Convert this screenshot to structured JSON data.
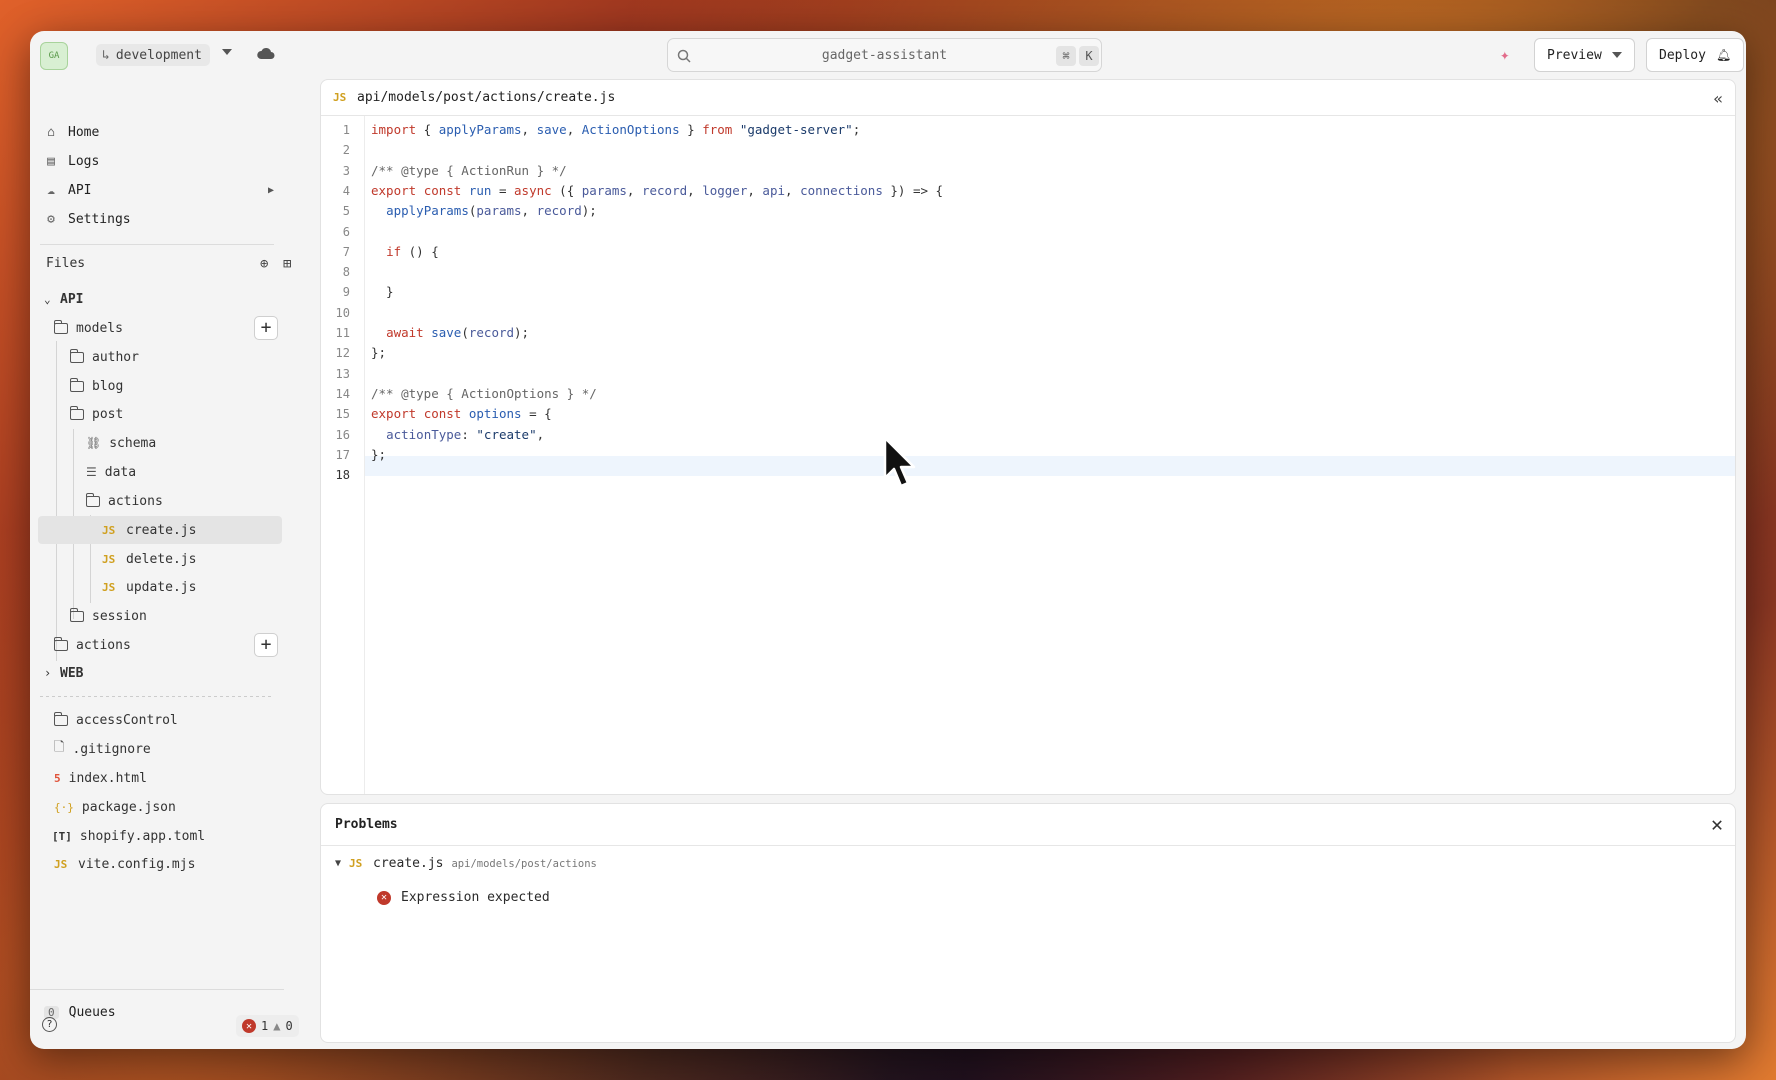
{
  "topbar": {
    "logo_text": "GA",
    "branch": "development",
    "search_value": "gadget-assistant",
    "shortcut_keys": [
      "⌘",
      "K"
    ],
    "preview_label": "Preview",
    "deploy_label": "Deploy"
  },
  "sidebar": {
    "nav": [
      {
        "label": "Home",
        "icon": "home-icon"
      },
      {
        "label": "Logs",
        "icon": "logs-icon"
      },
      {
        "label": "API",
        "icon": "cloud-icon"
      },
      {
        "label": "Settings",
        "icon": "gear-icon"
      }
    ],
    "files_header": "Files",
    "tree": {
      "api_label": "API",
      "models": "models",
      "author": "author",
      "blog": "blog",
      "post": "post",
      "schema": "schema",
      "data": "data",
      "actions_sub": "actions",
      "create": "create.js",
      "delete": "delete.js",
      "update": "update.js",
      "session": "session",
      "actions": "actions",
      "web_label": "WEB",
      "accessControl": "accessControl",
      "gitignore": ".gitignore",
      "index_html": "index.html",
      "package_json": "package.json",
      "shopify_toml": "shopify.app.toml",
      "vite_config": "vite.config.mjs"
    },
    "queues_count": "0",
    "queues_label": "Queues",
    "error_count": "1",
    "warning_count": "0"
  },
  "editor": {
    "tab_badge": "JS",
    "file_path": "api/models/post/actions/create.js",
    "current_line": 18,
    "lines": [
      "import { applyParams, save, ActionOptions } from \"gadget-server\";",
      "",
      "/** @type { ActionRun } */",
      "export const run = async ({ params, record, logger, api, connections }) => {",
      "  applyParams(params, record);",
      "",
      "  if () {",
      "",
      "  }",
      "",
      "  await save(record);",
      "};",
      "",
      "/** @type { ActionOptions } */",
      "export const options = {",
      "  actionType: \"create\",",
      "};",
      ""
    ]
  },
  "problems": {
    "title": "Problems",
    "file": "create.js",
    "file_path": "api/models/post/actions",
    "message": "Expression expected"
  }
}
